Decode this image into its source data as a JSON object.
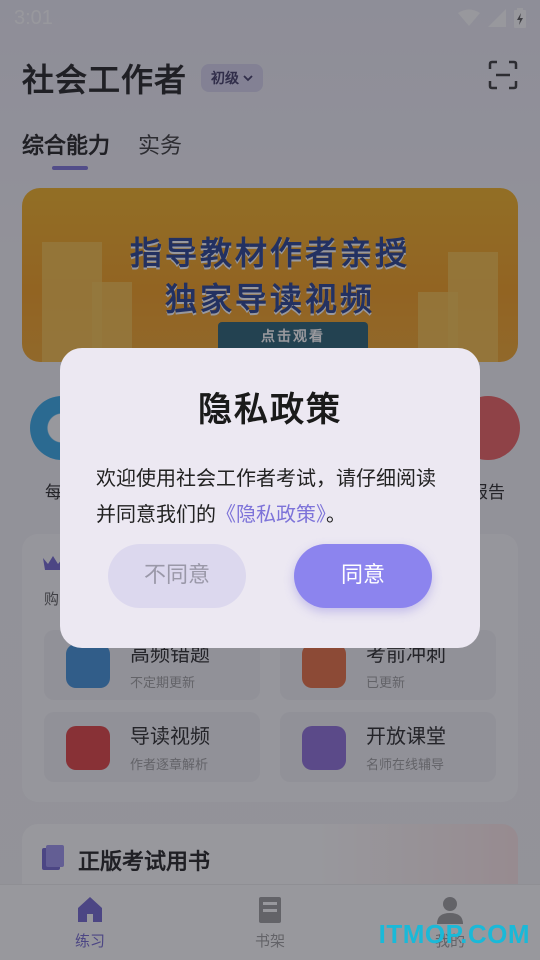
{
  "status_bar": {
    "time": "3:01"
  },
  "header": {
    "title": "社会工作者",
    "level": "初级"
  },
  "tabs": [
    {
      "label": "综合能力"
    },
    {
      "label": "实务"
    }
  ],
  "banner": {
    "line1": "指导教材作者亲授",
    "line2": "独家导读视频",
    "cta": "点击观看"
  },
  "quick": {
    "left_label": "每日",
    "right_label": "报告"
  },
  "card": {
    "head_label": "购",
    "tiles": [
      {
        "title": "高频错题",
        "subtitle": "不定期更新"
      },
      {
        "title": "考前冲刺",
        "subtitle": "已更新"
      },
      {
        "title": "导读视频",
        "subtitle": "作者逐章解析"
      },
      {
        "title": "开放课堂",
        "subtitle": "名师在线辅导"
      }
    ]
  },
  "section2": {
    "title": "正版考试用书"
  },
  "bottom_nav": [
    {
      "label": "练习"
    },
    {
      "label": "书架"
    },
    {
      "label": "我的"
    }
  ],
  "dialog": {
    "title": "隐私政策",
    "body_before": "欢迎使用社会工作者考试，请仔细阅读并同意我们的",
    "link": "《隐私政策》",
    "body_after": "。",
    "disagree": "不同意",
    "agree": "同意"
  },
  "watermark": "ITMOP.COM",
  "colors": {
    "accent": "#8c84ee",
    "link": "#7d73d9",
    "banner": "#f39b15"
  }
}
